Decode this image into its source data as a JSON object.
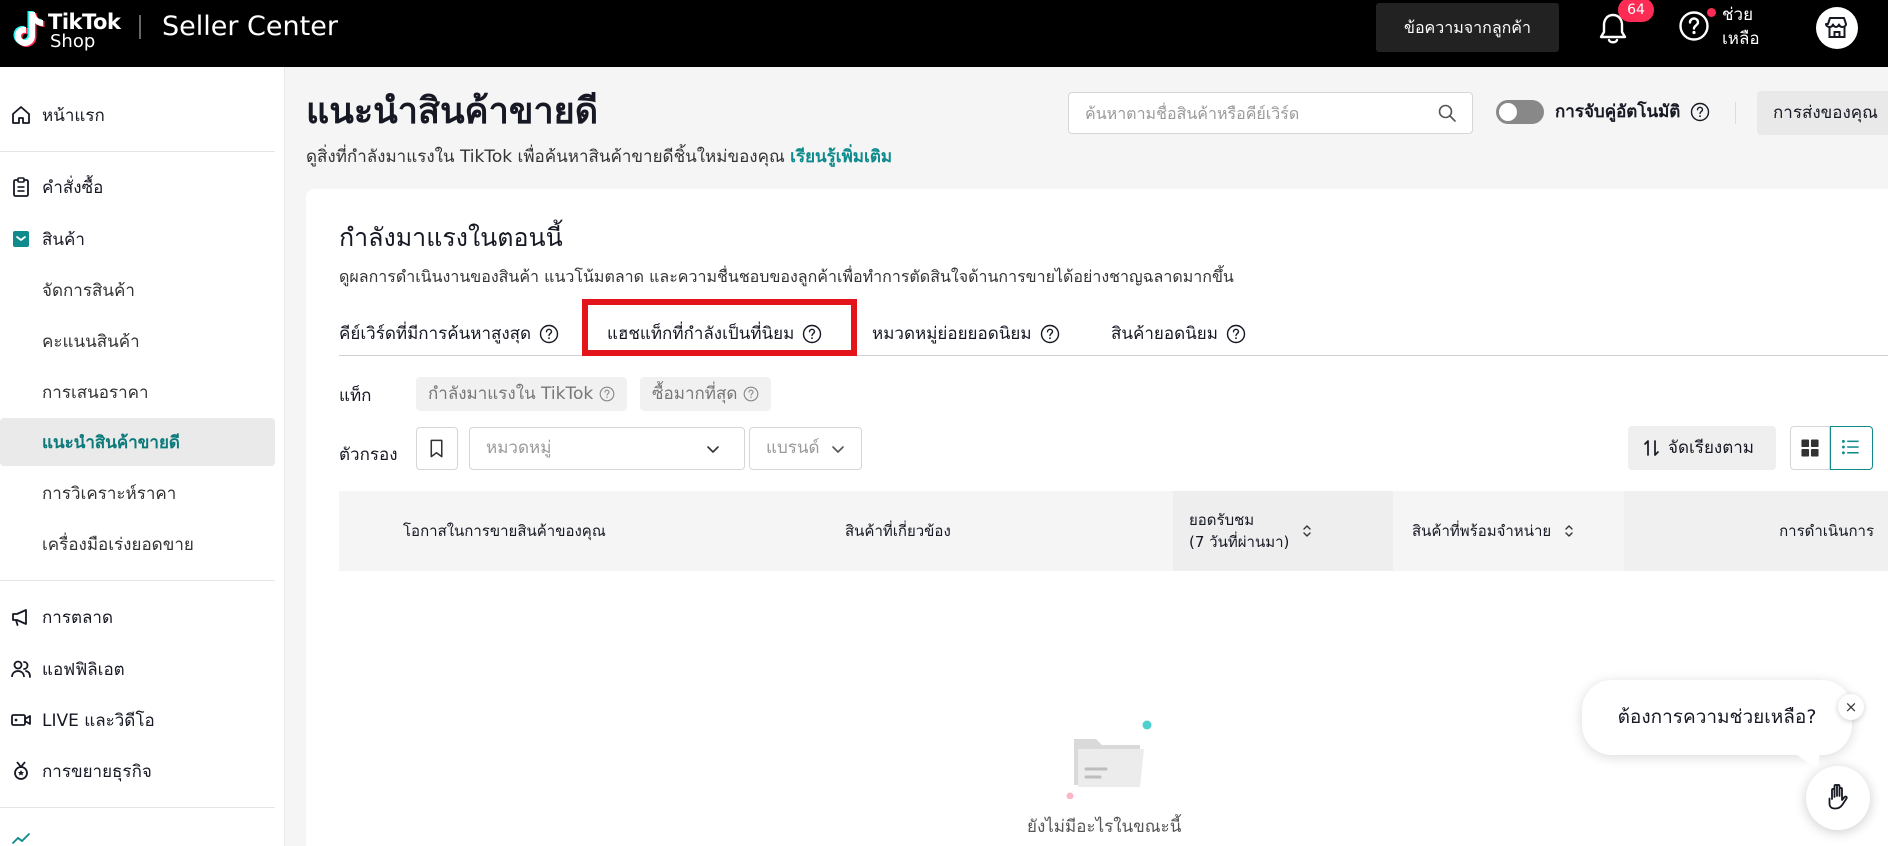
{
  "header": {
    "logo_tiktok": "TikTok",
    "logo_shop": "Shop",
    "app_title": "Seller Center",
    "messages_button": "ข้อความจากลูกค้า",
    "notifications_count": "64",
    "help_label": "ช่วย\nเหลือ"
  },
  "sidebar": {
    "home": "หน้าแรก",
    "orders": "คำสั่งซื้อ",
    "products": "สินค้า",
    "sub_items": [
      "จัดการสินค้า",
      "คะแนนสินค้า",
      "การเสนอราคา",
      "แนะนำสินค้าขายดี",
      "การวิเคราะห์ราคา",
      "เครื่องมือเร่งยอดขาย"
    ],
    "marketing": "การตลาด",
    "affiliate": "แอฟฟิลิเอต",
    "live_video": "LIVE และวิดีโอ",
    "growth": "การขยายธุรกิจ"
  },
  "page": {
    "title": "แนะนำสินค้าขายดี",
    "description": "ดูสิ่งที่กำลังมาแรงใน TikTok เพื่อค้นหาสินค้าขายดีชิ้นใหม่ของคุณ",
    "learn_more": "เรียนรู้เพิ่มเติม",
    "search_placeholder": "ค้นหาตามชื่อสินค้าหรือคีย์เวิร์ด",
    "auto_match_label": "การจับคู่อัตโนมัติ",
    "auto_match_on": false,
    "shipping_button": "การส่งของคุณ"
  },
  "card": {
    "title": "กำลังมาแรงในตอนนี้",
    "description": "ดูผลการดำเนินงานของสินค้า แนวโน้มตลาด และความชื่นชอบของลูกค้าเพื่อทำการตัดสินใจด้านการขายได้อย่างชาญฉลาดมากขึ้น",
    "tabs": [
      "คีย์เวิร์ดที่มีการค้นหาสูงสุด",
      "แฮชแท็กที่กำลังเป็นที่นิยม",
      "หมวดหมู่ย่อยยอดนิยม",
      "สินค้ายอดนิยม"
    ],
    "tag_label": "แท็ก",
    "chips": [
      "กำลังมาแรงใน TikTok",
      "ซื้อมากที่สุด"
    ],
    "filter_label": "ตัวกรอง",
    "category_placeholder": "หมวดหมู่",
    "brand_placeholder": "แบรนด์",
    "sort_button": "จัดเรียงตาม",
    "columns": [
      "โอกาสในการขายสินค้าของคุณ",
      "สินค้าที่เกี่ยวข้อง",
      "ยอดรับชม\n(7 วันที่ผ่านมา)",
      "สินค้าที่พร้อมจำหน่าย",
      "การดำเนินการ"
    ],
    "empty_text": "ยังไม่มีอะไรในขณะนี้"
  },
  "help_bubble": {
    "text": "ต้องการความช่วยเหลือ?",
    "close": "×"
  },
  "colors": {
    "accent": "#0f8b8d",
    "highlight": "#e4141b",
    "badge": "#fe2c55"
  }
}
